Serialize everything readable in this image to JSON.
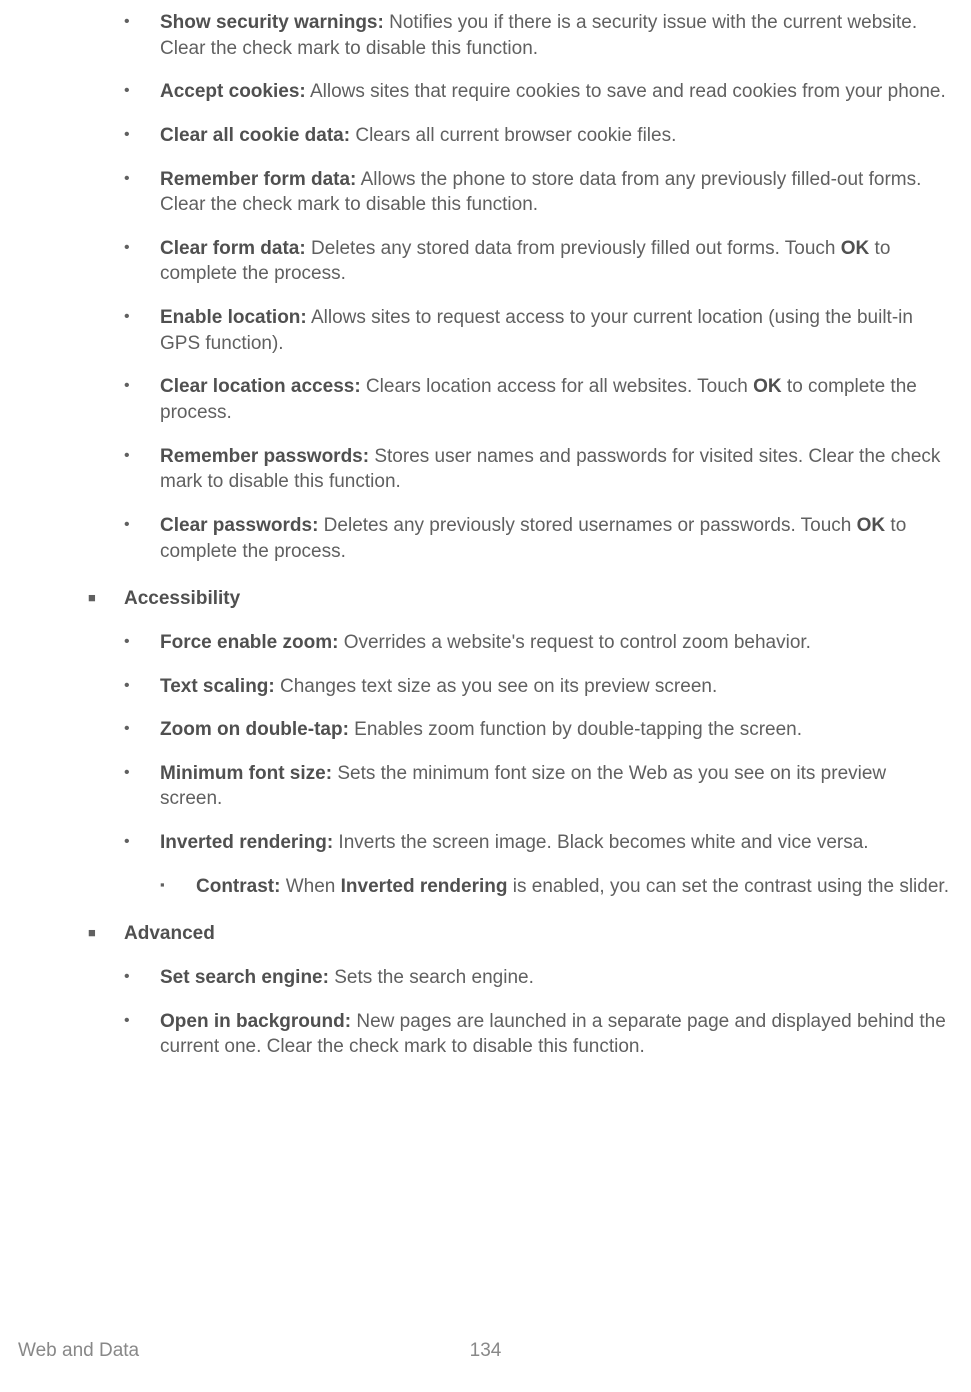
{
  "items_pre": [
    {
      "label": "Show security warnings:",
      "desc": " Notifies you if there is a security issue with the current website. Clear the check mark to disable this function."
    },
    {
      "label": "Accept cookies:",
      "desc": " Allows sites that require cookies to save and read cookies from your phone."
    },
    {
      "label": "Clear all cookie data:",
      "desc": " Clears all current browser cookie files."
    },
    {
      "label": "Remember form data:",
      "desc": " Allows the phone to store data from any previously filled-out forms. Clear the check mark to disable this function."
    },
    {
      "label": "Clear form data:",
      "desc_pre": " Deletes any stored data from previously filled out forms. Touch ",
      "bold_in": "OK",
      "desc_post": " to complete the process."
    },
    {
      "label": "Enable location:",
      "desc": " Allows sites to request access to your current location (using the built-in GPS function)."
    },
    {
      "label": "Clear location access:",
      "desc_pre": " Clears location access for all websites. Touch ",
      "bold_in": "OK",
      "desc_post": " to complete the process."
    },
    {
      "label": "Remember passwords:",
      "desc": " Stores user names and passwords for visited sites. Clear the check mark to disable this function."
    },
    {
      "label": "Clear passwords:",
      "desc_pre": " Deletes any previously stored usernames or passwords. Touch ",
      "bold_in": "OK",
      "desc_post": " to complete the process."
    }
  ],
  "sections": [
    {
      "title": "Accessibility",
      "items": [
        {
          "label": "Force enable zoom:",
          "desc": " Overrides a website's request to control zoom behavior."
        },
        {
          "label": "Text scaling:",
          "desc": " Changes text size as you see on its preview screen."
        },
        {
          "label": "Zoom on double-tap:",
          "desc": " Enables zoom function by double-tapping the screen."
        },
        {
          "label": "Minimum font size:",
          "desc": " Sets the minimum font size on the Web as you see on its preview screen."
        },
        {
          "label": "Inverted rendering:",
          "desc": " Inverts the screen image. Black becomes white and vice versa.",
          "sub": {
            "label": "Contrast:",
            "desc_pre": " When ",
            "bold_in": "Inverted rendering",
            "desc_post": " is enabled, you can set the contrast using the slider."
          }
        }
      ]
    },
    {
      "title": "Advanced",
      "items": [
        {
          "label": "Set search engine:",
          "desc": " Sets the search engine."
        },
        {
          "label": "Open in background:",
          "desc": " New pages are launched in a separate page and displayed behind the current one. Clear the check mark to disable this function."
        }
      ]
    }
  ],
  "footer": {
    "title": "Web and Data",
    "page": "134"
  }
}
